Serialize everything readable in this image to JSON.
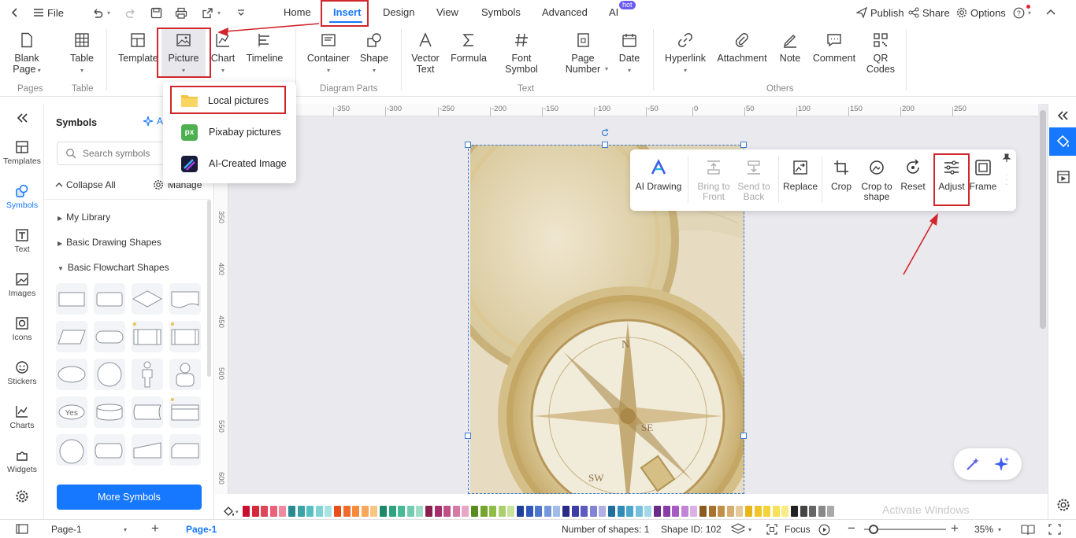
{
  "topbar": {
    "file": "File",
    "tabs": [
      "Home",
      "Insert",
      "Design",
      "View",
      "Symbols",
      "Advanced",
      "AI"
    ],
    "ai_badge": "hot",
    "publish": "Publish",
    "share": "Share",
    "options": "Options"
  },
  "ribbon": {
    "buttons": [
      {
        "label": "Blank\nPage",
        "icon": "blank-page-icon"
      },
      {
        "label": "Table",
        "icon": "table-icon"
      },
      {
        "label": "Template",
        "icon": "template-icon"
      },
      {
        "label": "Picture",
        "icon": "picture-icon"
      },
      {
        "label": "Chart",
        "icon": "chart-icon"
      },
      {
        "label": "Timeline",
        "icon": "timeline-icon"
      },
      {
        "label": "Container",
        "icon": "container-icon"
      },
      {
        "label": "Shape",
        "icon": "shape-icon"
      },
      {
        "label": "Vector\nText",
        "icon": "vector-text-icon"
      },
      {
        "label": "Formula",
        "icon": "formula-icon"
      },
      {
        "label": "Font\nSymbol",
        "icon": "font-symbol-icon"
      },
      {
        "label": "Page\nNumber",
        "icon": "page-number-icon"
      },
      {
        "label": "Date",
        "icon": "date-icon"
      },
      {
        "label": "Hyperlink",
        "icon": "hyperlink-icon"
      },
      {
        "label": "Attachment",
        "icon": "attachment-icon"
      },
      {
        "label": "Note",
        "icon": "note-icon"
      },
      {
        "label": "Comment",
        "icon": "comment-icon"
      },
      {
        "label": "QR\nCodes",
        "icon": "qr-codes-icon"
      }
    ],
    "groups": [
      "Pages",
      "Table",
      "Diagram Parts",
      "Text",
      "Others"
    ]
  },
  "picture_menu": {
    "items": [
      "Local pictures",
      "Pixabay pictures",
      "AI-Created Image"
    ]
  },
  "leftbar": {
    "items": [
      "Templates",
      "Symbols",
      "Text",
      "Images",
      "Icons",
      "Stickers",
      "Charts",
      "Widgets"
    ]
  },
  "symbols": {
    "title": "Symbols",
    "ai_label": "AI",
    "search_placeholder": "Search symbols",
    "collapse_all": "Collapse All",
    "manage": "Manage",
    "categories": [
      "My Library",
      "Basic Drawing Shapes",
      "Basic Flowchart Shapes"
    ],
    "yes_label": "Yes",
    "more_button": "More Symbols"
  },
  "rulers": {
    "h": [
      "-350",
      "-300",
      "-250",
      "-200",
      "-150",
      "-100",
      "-50",
      "0",
      "50",
      "100",
      "150",
      "200",
      "250"
    ],
    "v": [
      "350",
      "400",
      "450",
      "500",
      "550",
      "600"
    ]
  },
  "image_toolbar": {
    "items": [
      {
        "label": "AI Drawing",
        "enabled": true
      },
      {
        "label": "Bring to\nFront",
        "enabled": false
      },
      {
        "label": "Send to\nBack",
        "enabled": false
      },
      {
        "label": "Replace",
        "enabled": true
      },
      {
        "label": "Crop",
        "enabled": true
      },
      {
        "label": "Crop to\nshape",
        "enabled": true
      },
      {
        "label": "Reset",
        "enabled": true
      },
      {
        "label": "Adjust",
        "enabled": true
      },
      {
        "label": "Frame",
        "enabled": true
      }
    ]
  },
  "palette": [
    "#c8102e",
    "#d6283a",
    "#e0465a",
    "#e8627a",
    "#ef8aa0",
    "#2a8a8f",
    "#3aa3a8",
    "#56bfc2",
    "#7fd3d4",
    "#a8e3e3",
    "#e84e1b",
    "#f06a2c",
    "#f48a3a",
    "#f7a85a",
    "#f9c585",
    "#1d8b6b",
    "#2ea37f",
    "#48b995",
    "#72ccae",
    "#a0dcc7",
    "#8a1f4e",
    "#a3306a",
    "#bf4f86",
    "#d57aa6",
    "#e8a6c6",
    "#5a8b1f",
    "#74a52e",
    "#8fbd48",
    "#acd06f",
    "#c9e29c",
    "#1f3f9a",
    "#2f58b8",
    "#4d76cc",
    "#7598db",
    "#a2bce9",
    "#2a2a8a",
    "#3d3da8",
    "#5b5bc2",
    "#8484d6",
    "#b0b0e6",
    "#1f6f9a",
    "#2f8cb8",
    "#4da7cc",
    "#75c0db",
    "#a2d6e9",
    "#6a2a8a",
    "#8a3da8",
    "#a55bc2",
    "#c184d6",
    "#dab0e6",
    "#8a5a1f",
    "#a8732e",
    "#c28f48",
    "#d6ae6f",
    "#e6ca9c",
    "#e8b41b",
    "#f0c52c",
    "#f4d33a",
    "#f7e05a",
    "#f9ec85",
    "#222222",
    "#444444",
    "#666666",
    "#888888",
    "#aaaaaa"
  ],
  "status": {
    "page_tab": "Page-1",
    "active_page": "Page-1",
    "shapes": "Number of shapes: 1",
    "shape_id": "Shape ID: 102",
    "focus": "Focus",
    "zoom": "35%",
    "watermark": "Activate Windows"
  },
  "colors": {
    "accent": "#1677ff",
    "highlight": "#d0262c"
  }
}
